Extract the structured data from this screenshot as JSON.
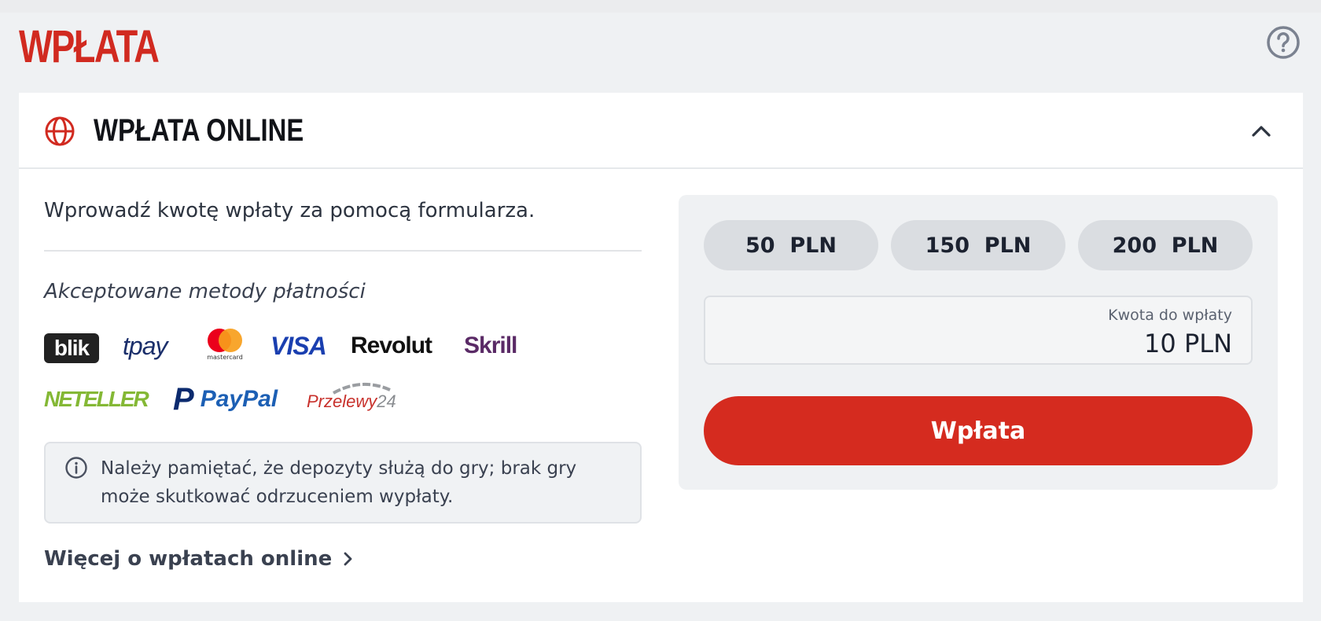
{
  "page": {
    "title": "WPŁATA"
  },
  "section": {
    "title": "WPŁATA ONLINE",
    "intro": "Wprowadź kwotę wpłaty za pomocą formularza.",
    "methods_heading": "Akceptowane metody płatności",
    "methods": {
      "blik": "blik",
      "tpay": "tpay",
      "mastercard": "mastercard",
      "visa": "VISA",
      "revolut": "Revolut",
      "skrill": "Skrill",
      "neteller": "NETELLER",
      "paypal_p": "P",
      "paypal": "PayPal",
      "przelewy": "Przelewy",
      "przelewy_24": "24"
    },
    "info": "Należy pamiętać, że depozyty służą do gry; brak gry może skutkować odrzuceniem wypłaty.",
    "more_link": "Więcej o wpłatach online"
  },
  "form": {
    "quick_amounts": [
      "50  PLN",
      "150  PLN",
      "200  PLN"
    ],
    "amount_label": "Kwota do wpłaty",
    "amount_value": "10 PLN",
    "submit_label": "Wpłata"
  },
  "colors": {
    "brand_red": "#d12a20",
    "button_red": "#d52b1f",
    "chip_gray": "#dadde1",
    "panel_gray": "#eff1f3"
  },
  "icons": {
    "help": "help-circle-icon",
    "section": "globe-icon",
    "collapse": "chevron-up-icon",
    "info": "info-icon",
    "link": "chevron-right-icon"
  }
}
